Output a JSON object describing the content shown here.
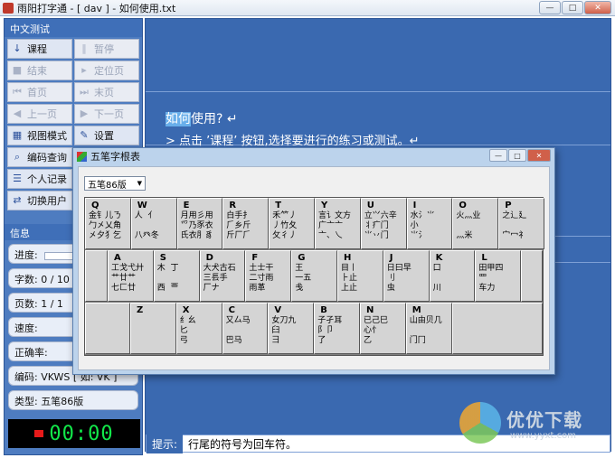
{
  "window": {
    "title": "雨阳打字通 - [ dav ] - 如何使用.txt",
    "minimize": "—",
    "maximize": "□",
    "close": "✕"
  },
  "left": {
    "section_title": "中文测试",
    "buttons": [
      {
        "label": "课程",
        "icon": "↓",
        "disabled": false
      },
      {
        "label": "暂停",
        "icon": "‖",
        "disabled": true
      },
      {
        "label": "结束",
        "icon": "■",
        "disabled": true
      },
      {
        "label": "定位页",
        "icon": "▸",
        "disabled": true
      },
      {
        "label": "首页",
        "icon": "⏮",
        "disabled": true
      },
      {
        "label": "末页",
        "icon": "⏭",
        "disabled": true
      },
      {
        "label": "上一页",
        "icon": "◀",
        "disabled": true
      },
      {
        "label": "下一页",
        "icon": "▶",
        "disabled": true
      },
      {
        "label": "视图模式",
        "icon": "▦",
        "disabled": false
      },
      {
        "label": "设置",
        "icon": "✎",
        "disabled": false
      },
      {
        "label": "编码查询",
        "icon": "⌕",
        "disabled": false
      },
      {
        "label": "",
        "icon": "",
        "disabled": false
      },
      {
        "label": "个人记录",
        "icon": "☰",
        "disabled": false
      },
      {
        "label": "",
        "icon": "",
        "disabled": false
      },
      {
        "label": "切换用户",
        "icon": "⇄",
        "disabled": false
      },
      {
        "label": "",
        "icon": "",
        "disabled": false
      }
    ],
    "info_title": "信息",
    "info": {
      "progress_label": "进度:",
      "progress_value": 0,
      "chars": "字数: 0 / 10",
      "pages": "页数: 1 / 1",
      "speed": "速度:",
      "accuracy": "正确率:",
      "code": "编码: VKWS [ 如: VK ]",
      "type": "类型: 五笔86版"
    },
    "clock": "00:00"
  },
  "main": {
    "line1_highlight": "如何",
    "line1_rest": "使用? ↵",
    "line2": "> 点击 ’课程’ 按钮,选择要进行的练习或测试。↵"
  },
  "hint": {
    "label": "提示:",
    "text": "行尾的符号为回车符。"
  },
  "dialog": {
    "title": "五笔字根表",
    "select_value": "五笔86版",
    "rows": [
      [
        {
          "letter": "Q",
          "glyphs": "金钅儿ㄋ\n勹㐅乂角\n㐅夕犭乞"
        },
        {
          "letter": "W",
          "glyphs": "人  亻\n\n八癶冬"
        },
        {
          "letter": "E",
          "glyphs": "月用彡用\n爫乃豕衣\n氏衣⺼豸"
        },
        {
          "letter": "R",
          "glyphs": "白手扌\n⺁乡斤\n斤厂⺁"
        },
        {
          "letter": "T",
          "glyphs": "禾⺮丿\n丿竹夂\n攵彳丿"
        },
        {
          "letter": "Y",
          "glyphs": "言讠文方\n广亠⼇\n⼇、乀"
        },
        {
          "letter": "U",
          "glyphs": "立⺍六辛\n丬疒门\n⺌丷门"
        },
        {
          "letter": "I",
          "glyphs": "水氵⺌\n小\n⺌氵"
        },
        {
          "letter": "O",
          "glyphs": "火灬业\n\n灬米"
        },
        {
          "letter": "P",
          "glyphs": "之辶廴\n\n宀冖礻"
        }
      ],
      [
        {
          "letter": "A",
          "glyphs": "工戈弋廾\n艹廿⺾\n七匚廿"
        },
        {
          "letter": "S",
          "glyphs": "木  丁\n\n西  覀"
        },
        {
          "letter": "D",
          "glyphs": "大犬古石\n三镸手\n厂ナ"
        },
        {
          "letter": "F",
          "glyphs": "土士干\n二寸雨\n雨革"
        },
        {
          "letter": "G",
          "glyphs": "王\n一五\n戋"
        },
        {
          "letter": "H",
          "glyphs": "目丨\n⺊止\n上止"
        },
        {
          "letter": "J",
          "glyphs": "日曰早\n刂\n虫"
        },
        {
          "letter": "K",
          "glyphs": "口\n\n川"
        },
        {
          "letter": "L",
          "glyphs": "田甲四\n罒\n车力"
        }
      ],
      [
        {
          "letter": "Z",
          "glyphs": ""
        },
        {
          "letter": "X",
          "glyphs": "纟幺\n匕\n弓"
        },
        {
          "letter": "C",
          "glyphs": "又厶马\n\n巴马"
        },
        {
          "letter": "V",
          "glyphs": "女刀九\n臼\n彐"
        },
        {
          "letter": "B",
          "glyphs": "子孑耳\n阝卩\n了"
        },
        {
          "letter": "N",
          "glyphs": "已己巳\n心忄\n乙"
        },
        {
          "letter": "M",
          "glyphs": "山由贝几\n\n门冂"
        }
      ]
    ]
  },
  "watermark": {
    "text": "优优下载",
    "url": "www.yyxt.com"
  }
}
